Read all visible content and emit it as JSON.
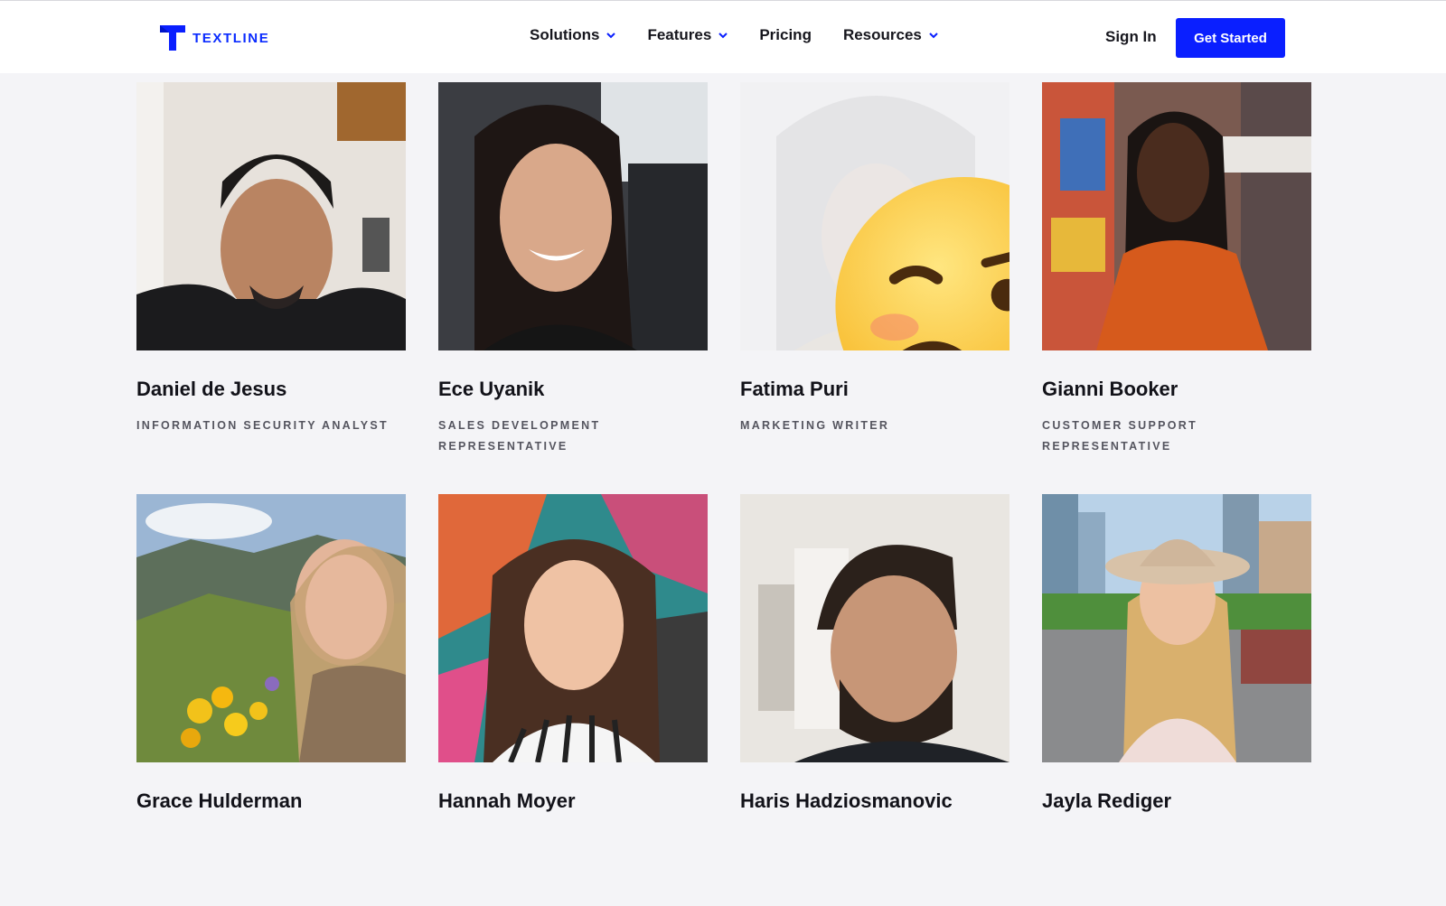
{
  "header": {
    "logo_text": "TEXTLINE",
    "nav": [
      {
        "label": "Solutions",
        "dropdown": true
      },
      {
        "label": "Features",
        "dropdown": true
      },
      {
        "label": "Pricing",
        "dropdown": false
      },
      {
        "label": "Resources",
        "dropdown": true
      }
    ],
    "sign_in": "Sign In",
    "cta": "Get Started",
    "brand_color": "#0a1fff"
  },
  "team": [
    {
      "name": "Daniel de Jesus",
      "role": "INFORMATION SECURITY ANALYST"
    },
    {
      "name": "Ece Uyanik",
      "role": "SALES DEVELOPMENT REPRESENTATIVE"
    },
    {
      "name": "Fatima Puri",
      "role": "MARKETING WRITER"
    },
    {
      "name": "Gianni Booker",
      "role": "CUSTOMER SUPPORT REPRESENTATIVE"
    },
    {
      "name": "Grace Hulderman",
      "role": ""
    },
    {
      "name": "Hannah Moyer",
      "role": ""
    },
    {
      "name": "Haris Hadziosmanovic",
      "role": ""
    },
    {
      "name": "Jayla Rediger",
      "role": ""
    }
  ]
}
